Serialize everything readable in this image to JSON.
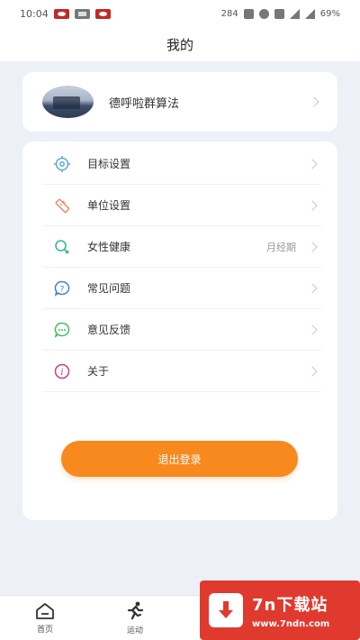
{
  "status_bar": {
    "time": "10:04",
    "battery": "69%",
    "net_speed": "284"
  },
  "header": {
    "title": "我的"
  },
  "profile": {
    "name": "德呼啦群算法"
  },
  "menu": [
    {
      "label": "目标设置",
      "icon": "target-icon",
      "extra": ""
    },
    {
      "label": "单位设置",
      "icon": "ruler-icon",
      "extra": ""
    },
    {
      "label": "女性健康",
      "icon": "female-health-icon",
      "extra": "月经期"
    },
    {
      "label": "常见问题",
      "icon": "question-icon",
      "extra": ""
    },
    {
      "label": "意见反馈",
      "icon": "chat-feedback-icon",
      "extra": ""
    },
    {
      "label": "关于",
      "icon": "info-icon",
      "extra": ""
    }
  ],
  "logout_label": "退出登录",
  "tabs": [
    {
      "label": "首页",
      "icon": "home-icon"
    },
    {
      "label": "运动",
      "icon": "running-icon"
    }
  ],
  "watermark": {
    "main": "7n下载站",
    "sub": "www.7ndn.com"
  },
  "colors": {
    "accent": "#f7891f",
    "background": "#eef0f8",
    "watermark": "#e03a2f"
  }
}
